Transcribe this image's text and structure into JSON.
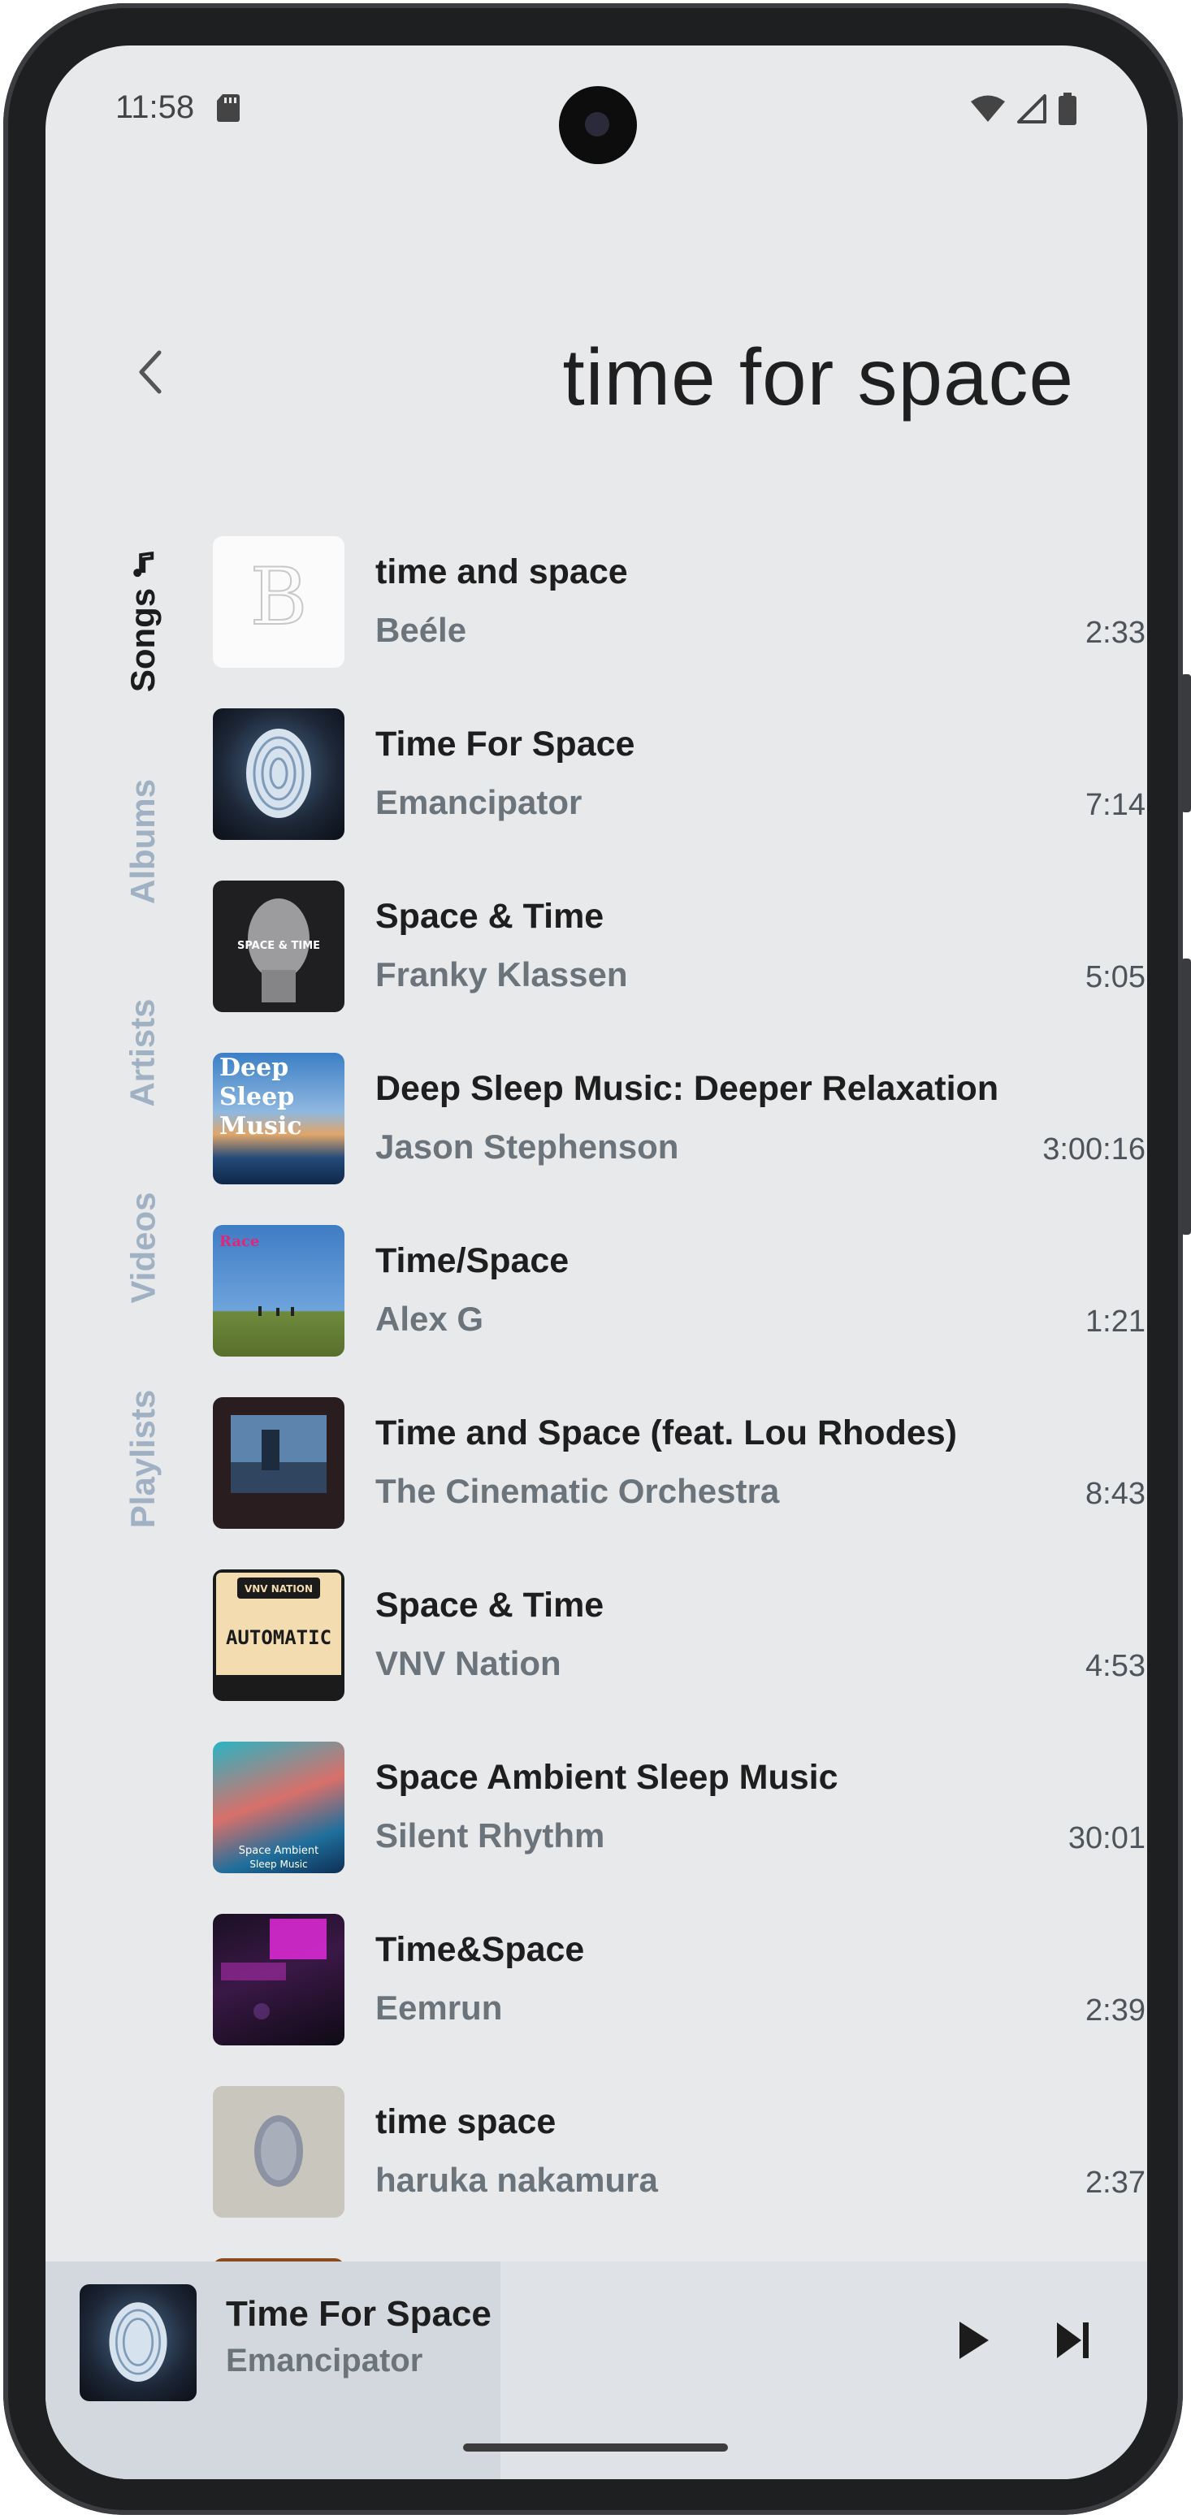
{
  "status_bar": {
    "time": "11:58",
    "icons": [
      "sd-card-icon",
      "wifi-icon",
      "signal-icon",
      "battery-icon"
    ]
  },
  "header": {
    "title": "time for space",
    "back_icon": "chevron-left-icon"
  },
  "tabs": [
    {
      "label": "Songs",
      "icon": "music-note-icon",
      "active": true
    },
    {
      "label": "Albums",
      "active": false
    },
    {
      "label": "Artists",
      "active": false
    },
    {
      "label": "Videos",
      "active": false
    },
    {
      "label": "Playlists",
      "active": false
    }
  ],
  "songs": [
    {
      "title": "time and space",
      "artist": "Beéle",
      "duration": "2:33"
    },
    {
      "title": "Time For Space",
      "artist": "Emancipator",
      "duration": "7:14"
    },
    {
      "title": "Space & Time",
      "artist": "Franky Klassen",
      "duration": "5:05",
      "art_text": "SPACE & TIME"
    },
    {
      "title": "Deep Sleep Music: Deeper Relaxation",
      "artist": "Jason Stephenson",
      "duration": "3:00:16",
      "art_text": [
        "Deep",
        "Sleep",
        "Music"
      ]
    },
    {
      "title": "Time/Space",
      "artist": "Alex G",
      "duration": "1:21",
      "art_text": "Race"
    },
    {
      "title": "Time and Space (feat. Lou Rhodes)",
      "artist": "The Cinematic Orchestra",
      "duration": "8:43"
    },
    {
      "title": "Space & Time",
      "artist": "VNV Nation",
      "duration": "4:53",
      "art_text": [
        "VNV NATION",
        "AUTOMATIC"
      ]
    },
    {
      "title": "Space Ambient Sleep Music",
      "artist": "Silent Rhythm",
      "duration": "30:01",
      "art_text": [
        "Space Ambient",
        "Sleep Music"
      ]
    },
    {
      "title": "Time&Space",
      "artist": "Eemrun",
      "duration": "2:39"
    },
    {
      "title": "time space",
      "artist": "haruka nakamura",
      "duration": "2:37"
    }
  ],
  "now_playing": {
    "title": "Time For Space",
    "artist": "Emancipator",
    "play_icon": "play-icon",
    "next_icon": "skip-next-icon"
  }
}
